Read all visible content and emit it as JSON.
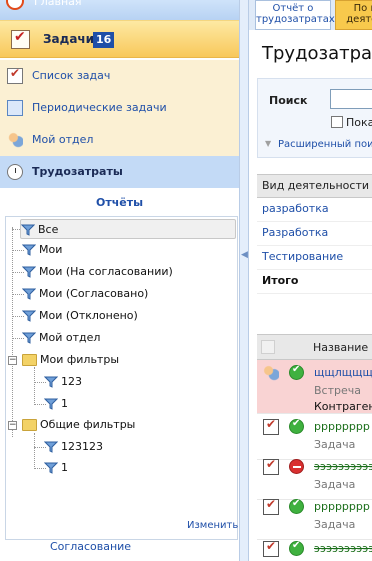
{
  "sidebar": {
    "home_label": "Главная",
    "tasks_label": "Задачи",
    "tasks_count": "16",
    "items": [
      {
        "label": "Список задач"
      },
      {
        "label": "Периодические задачи"
      },
      {
        "label": "Мой отдел"
      },
      {
        "label": "Трудозатраты"
      }
    ],
    "reports_header": "Отчёты",
    "tree": {
      "nodes": [
        "Все",
        "Мои",
        "Мои (На согласовании)",
        "Мои (Согласовано)",
        "Мои (Отклонено)",
        "Мой отдел"
      ],
      "my_filters_label": "Мои фильтры",
      "my_filters": [
        "123",
        "1"
      ],
      "common_filters_label": "Общие фильтры",
      "common_filters": [
        "123123",
        "1"
      ]
    },
    "edit_label": "Изменить",
    "approval_label": "Согласование"
  },
  "tabs": {
    "tab1": "Отчёт о трудозатратах",
    "tab2": "По в деятел"
  },
  "page_title": "Трудозатраты",
  "search": {
    "label": "Поиск",
    "value": "",
    "checkbox_label": "Пока",
    "advanced_label": "Расширенный поис"
  },
  "activity_grid": {
    "header": "Вид деятельности",
    "rows": [
      "разработка",
      "Разработка",
      "Тестирование"
    ],
    "total": "Итого"
  },
  "tasks_grid": {
    "header_name": "Название",
    "rows": [
      {
        "title": "щщлщщщщщ",
        "type": "Встреча",
        "extra": "Контрагент",
        "icon": "people-icon",
        "status": "ok"
      },
      {
        "title": "рррррррр",
        "type": "Задача",
        "icon": "task-icon",
        "status": "ok"
      },
      {
        "title": "ээээээээээ",
        "type": "Задача",
        "icon": "task-icon",
        "status": "rejected"
      },
      {
        "title": "рррррррр",
        "type": "Задача",
        "icon": "task-icon",
        "status": "ok"
      },
      {
        "title": "ээээээээээ",
        "type": "",
        "icon": "task-icon",
        "status": "ok"
      }
    ]
  }
}
